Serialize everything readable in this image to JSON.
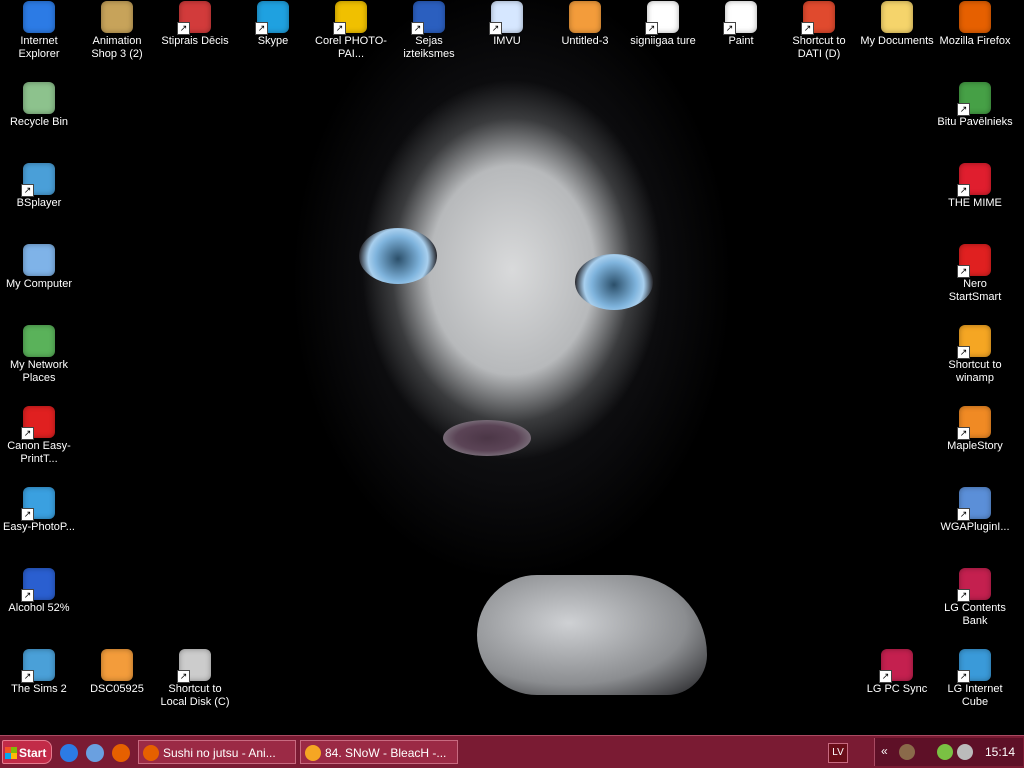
{
  "desktop": {
    "icons": [
      {
        "label": "Internet Explorer",
        "icon": "internet-explorer-icon",
        "color": "#2c7be5"
      },
      {
        "label": "Animation Shop 3 (2)",
        "icon": "animation-shop-icon",
        "color": "#c7a35a"
      },
      {
        "label": "Stiprais Dēcis",
        "icon": "security-shield-icon",
        "color": "#d23b3b"
      },
      {
        "label": "Skype",
        "icon": "skype-icon",
        "color": "#1fa1e0"
      },
      {
        "label": "Corel PHOTO-PAI...",
        "icon": "corel-photo-paint-icon",
        "color": "#f0c000"
      },
      {
        "label": "Sejas izteiksmes",
        "icon": "word-document-icon",
        "color": "#2b5fbf"
      },
      {
        "label": "IMVU",
        "icon": "chat-bubble-icon",
        "color": "#d6e7ff"
      },
      {
        "label": "Untitled-3",
        "icon": "image-file-icon",
        "color": "#f39c3b"
      },
      {
        "label": "signiigaa ture",
        "icon": "image-file-icon",
        "color": "#ffffff"
      },
      {
        "label": "Paint",
        "icon": "paint-icon",
        "color": "#ffffff"
      },
      {
        "label": "Shortcut to DATI (D)",
        "icon": "power-drive-icon",
        "color": "#e04a2e"
      },
      {
        "label": "My Documents",
        "icon": "folder-icon",
        "color": "#f5d46b"
      },
      {
        "label": "Mozilla Firefox",
        "icon": "firefox-icon",
        "color": "#e66000"
      },
      {
        "label": "Recycle Bin",
        "icon": "recycle-bin-icon",
        "color": "#8dc28d"
      },
      {
        "label": "BSplayer",
        "icon": "media-player-icon",
        "color": "#4a9fd8"
      },
      {
        "label": "My Computer",
        "icon": "computer-icon",
        "color": "#7fb3e8"
      },
      {
        "label": "My Network Places",
        "icon": "network-places-icon",
        "color": "#5ab25a"
      },
      {
        "label": "Canon Easy-PrintT...",
        "icon": "printer-toolbox-icon",
        "color": "#e02020"
      },
      {
        "label": "Easy-PhotoP...",
        "icon": "photo-print-icon",
        "color": "#3aa0e0"
      },
      {
        "label": "Alcohol 52%",
        "icon": "alcohol-disc-icon",
        "color": "#2a5fd0"
      },
      {
        "label": "The Sims 2",
        "icon": "sims-plumbob-icon",
        "color": "#4aa0d8"
      },
      {
        "label": "DSC05925",
        "icon": "image-file-icon",
        "color": "#f39c3b"
      },
      {
        "label": "Shortcut to Local Disk (C)",
        "icon": "hard-drive-icon",
        "color": "#cccccc"
      },
      {
        "label": "Bitu Pavēlnieks",
        "icon": "game-icon",
        "color": "#46a046"
      },
      {
        "label": "THE MIME",
        "icon": "red-x-icon",
        "color": "#e01e2e"
      },
      {
        "label": "Nero StartSmart",
        "icon": "nero-icon",
        "color": "#e02020"
      },
      {
        "label": "Shortcut to winamp",
        "icon": "winamp-icon",
        "color": "#f5a623"
      },
      {
        "label": "MapleStory",
        "icon": "maplestory-mushroom-icon",
        "color": "#f08a24"
      },
      {
        "label": "WGAPluginI...",
        "icon": "installer-icon",
        "color": "#5b8fd8"
      },
      {
        "label": "LG Contents Bank",
        "icon": "lg-logo-icon",
        "color": "#c4204f"
      },
      {
        "label": "LG PC Sync",
        "icon": "lg-logo-icon",
        "color": "#c4204f"
      },
      {
        "label": "LG Internet Cube",
        "icon": "globe-icon",
        "color": "#3a9ad9"
      }
    ]
  },
  "taskbar": {
    "start_label": "Start",
    "quick_launch": [
      {
        "icon": "internet-explorer-icon",
        "color": "#2c7be5"
      },
      {
        "icon": "document-icon",
        "color": "#6aa0e0"
      },
      {
        "icon": "firefox-icon",
        "color": "#e66000"
      }
    ],
    "tasks": [
      {
        "label": "Sushi no jutsu - Ani...",
        "icon": "firefox-icon",
        "color": "#e66000"
      },
      {
        "label": "84. SNoW - BleacH -...",
        "icon": "winamp-icon",
        "color": "#f5a623"
      }
    ],
    "language": "LV",
    "tray_expand": "«",
    "clock": "15:14",
    "tray_icons": [
      {
        "icon": "tray-app-icon",
        "color": "#8a6a4a"
      },
      {
        "icon": "messenger-icon",
        "color": "#7ac143"
      },
      {
        "icon": "speaker-icon",
        "color": "#bbbbbb"
      }
    ]
  }
}
